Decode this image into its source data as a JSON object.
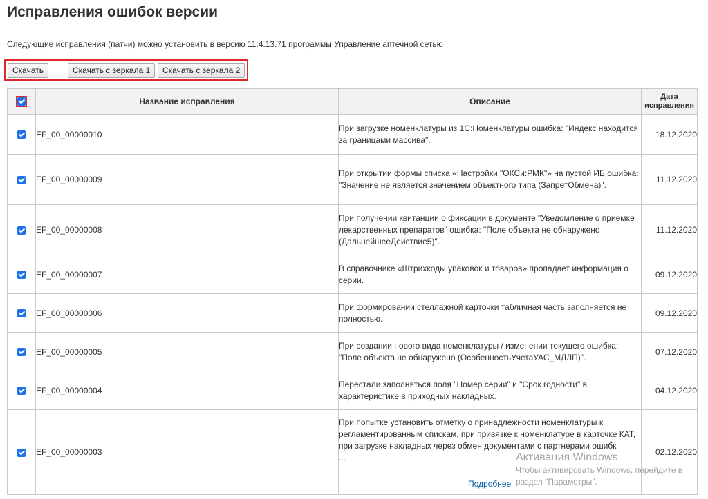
{
  "page": {
    "title": "Исправления ошибок версии",
    "subtitle": "Следующие исправления (патчи) можно установить в версию 11.4.13.71 программы Управление аптечной сетью"
  },
  "buttons": {
    "download": "Скачать",
    "mirror1": "Скачать с зеркала 1",
    "mirror2": "Скачать с зеркала 2"
  },
  "table": {
    "headers": {
      "name": "Название исправления",
      "description": "Описание",
      "date": "Дата исправления"
    },
    "select_all_checked": true,
    "rows": [
      {
        "checked": true,
        "name": "EF_00_00000010",
        "description": "При загрузке номенклатуры из 1С:Номенклатуры ошибка: \"Индекс находится за границами массива\".",
        "date": "18.12.2020"
      },
      {
        "checked": true,
        "name": "EF_00_00000009",
        "description": "При открытии формы списка «Настройки \"ОКСи:РМК\"» на пустой ИБ ошибка: \"Значение не является значением объектного типа (ЗапретОбмена)\".",
        "date": "11.12.2020"
      },
      {
        "checked": true,
        "name": "EF_00_00000008",
        "description": "При получении квитанции о фиксации в документе \"Уведомление о приемке лекарственных препаратов\" ошибка: \"Поле объекта не обнаружено (ДальнейшееДействие5)\".",
        "date": "11.12.2020"
      },
      {
        "checked": true,
        "name": "EF_00_00000007",
        "description": "В справочнике «Штрихкоды упаковок и товаров» пропадает информация о серии.",
        "date": "09.12.2020"
      },
      {
        "checked": true,
        "name": "EF_00_00000006",
        "description": "При формировании стеллажной карточки табличная часть заполняется не полностью.",
        "date": "09.12.2020"
      },
      {
        "checked": true,
        "name": "EF_00_00000005",
        "description": "При создании нового вида номенклатуры / изменении текущего ошибка: \"Поле объекта не обнаружено (ОсобенностьУчетаУАС_МДЛП)\".",
        "date": "07.12.2020"
      },
      {
        "checked": true,
        "name": "EF_00_00000004",
        "description": "Перестали заполняться поля \"Номер серии\" и \"Срок годности\" в характеристике в приходных накладных.",
        "date": "04.12.2020"
      },
      {
        "checked": true,
        "name": "EF_00_00000003",
        "description": "При попытке установить отметку о принадлежности номенклатуры к регламентированным спискам, при привязке к номенклатуре в карточке КАТ, при загрузке накладных через обмен документами с партнерами ошибк",
        "ellipsis": "...",
        "more_link": "Подробнее",
        "date": "02.12.2020"
      }
    ]
  },
  "watermark": {
    "title": "Активация Windows",
    "text": "Чтобы активировать Windows, перейдите в раздел \"Параметры\"."
  },
  "colors": {
    "highlight": "#e0262f",
    "checkbox": "#1a73e8",
    "link": "#0a5da8"
  }
}
